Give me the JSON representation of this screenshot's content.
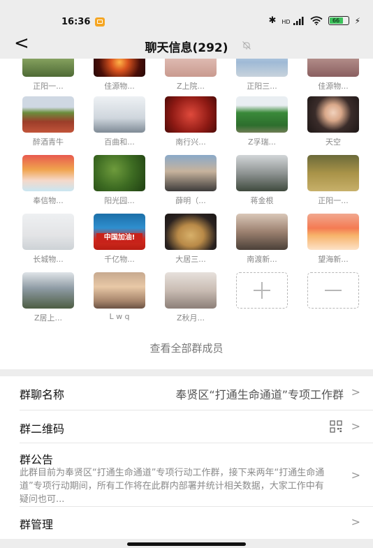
{
  "status_bar": {
    "time": "16:36",
    "bluetooth": "✱",
    "network": "HD",
    "battery": "66",
    "charge": "⚡"
  },
  "nav": {
    "back": "<",
    "title": "聊天信息(292)"
  },
  "members": [
    {
      "name": "正阳一...",
      "thumb": "bamboo"
    },
    {
      "name": "佳源物...",
      "thumb": "fire"
    },
    {
      "name": "Z上院...",
      "thumb": "pink"
    },
    {
      "name": "正阳三...",
      "thumb": "sky"
    },
    {
      "name": "佳源物...",
      "thumb": "dusk"
    },
    {
      "name": "醉酒青牛",
      "thumb": "flowers"
    },
    {
      "name": "百曲和...",
      "thumb": "room"
    },
    {
      "name": "南行兴...",
      "thumb": "red"
    },
    {
      "name": "Z孚瑞...",
      "thumb": "elephants"
    },
    {
      "name": "天空",
      "thumb": "girl"
    },
    {
      "name": "奉信物...",
      "thumb": "baby"
    },
    {
      "name": "阳光园...",
      "thumb": "leaves"
    },
    {
      "name": "薛明（...",
      "thumb": "kid"
    },
    {
      "name": "蒋金根",
      "thumb": "house"
    },
    {
      "name": "正阳一...",
      "thumb": "autumn"
    },
    {
      "name": "长城物...",
      "thumb": "child-red"
    },
    {
      "name": "千亿物...",
      "thumb": "china",
      "badge": "中国加油!"
    },
    {
      "name": "大居三...",
      "thumb": "pancake"
    },
    {
      "name": "南渡新...",
      "thumb": "man"
    },
    {
      "name": "望海新...",
      "thumb": "sunset"
    },
    {
      "name": "Z居上...",
      "thumb": "garden"
    },
    {
      "name": "L w q",
      "thumb": "silhouette"
    },
    {
      "name": "Z秋月...",
      "thumb": "boy-balloon"
    }
  ],
  "add_member": {
    "label": "+"
  },
  "remove_member": {
    "label": "−"
  },
  "view_all": "查看全部群成员",
  "settings": {
    "group_name_label": "群聊名称",
    "group_name_value": "奉贤区“打通生命通道”专项工作群",
    "qr_label": "群二维码",
    "notice_label": "群公告",
    "notice_text": "此群目前为奉贤区“打通生命通道”专项行动工作群，接下来两年“打通生命通道”专项行动期间，所有工作将在此群内部署并统计相关数据，大家工作中有疑问也可...",
    "manage_label": "群管理",
    "chevron": ">"
  },
  "colors": {
    "page_bg": "#ffffff",
    "bar_bg": "#ededed",
    "muted_text": "#888888",
    "battery": "#3bc25a"
  }
}
